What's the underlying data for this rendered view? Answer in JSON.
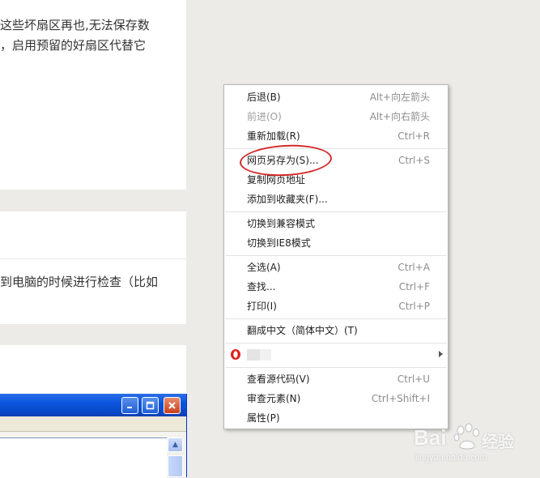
{
  "article": {
    "card1_line1": "这些坏扇区再也,无法保存数",
    "card1_line2": "，启用预留的好扇区代替它",
    "card2_line1": "到电脑的时候进行检查（比如"
  },
  "context_menu": {
    "items": [
      {
        "label": "后退(B)",
        "shortcut": "Alt+向左箭头",
        "disabled": false
      },
      {
        "label": "前进(O)",
        "shortcut": "Alt+向右箭头",
        "disabled": true
      },
      {
        "label": "重新加载(R)",
        "shortcut": "Ctrl+R",
        "disabled": false
      },
      {
        "label": "网页另存为(S)...",
        "shortcut": "Ctrl+S",
        "disabled": false
      },
      {
        "label": "复制网页地址",
        "shortcut": "",
        "disabled": false
      },
      {
        "label": "添加到收藏夹(F)...",
        "shortcut": "",
        "disabled": false
      },
      {
        "label": "切换到兼容模式",
        "shortcut": "",
        "disabled": false
      },
      {
        "label": "切换到IE8模式",
        "shortcut": "",
        "disabled": false
      },
      {
        "label": "全选(A)",
        "shortcut": "Ctrl+A",
        "disabled": false
      },
      {
        "label": "查找...",
        "shortcut": "Ctrl+F",
        "disabled": false
      },
      {
        "label": "打印(I)",
        "shortcut": "Ctrl+P",
        "disabled": false
      },
      {
        "label": "翻成中文（简体中文）(T)",
        "shortcut": "",
        "disabled": false
      },
      {
        "label": "",
        "shortcut": "",
        "disabled": false
      },
      {
        "label": "查看源代码(V)",
        "shortcut": "Ctrl+U",
        "disabled": false
      },
      {
        "label": "审查元素(N)",
        "shortcut": "Ctrl+Shift+I",
        "disabled": false
      },
      {
        "label": "属性(P)",
        "shortcut": "",
        "disabled": false
      }
    ],
    "highlighted_item": "网页另存为(S)..."
  },
  "watermark": {
    "brand": "Bai",
    "brand_cn": "经验",
    "url": "jingyan.baidu.com"
  },
  "colors": {
    "highlight_ellipse": "#d42a2a",
    "xp_titlebar": "#0a55dd",
    "background": "#ecebe8"
  }
}
